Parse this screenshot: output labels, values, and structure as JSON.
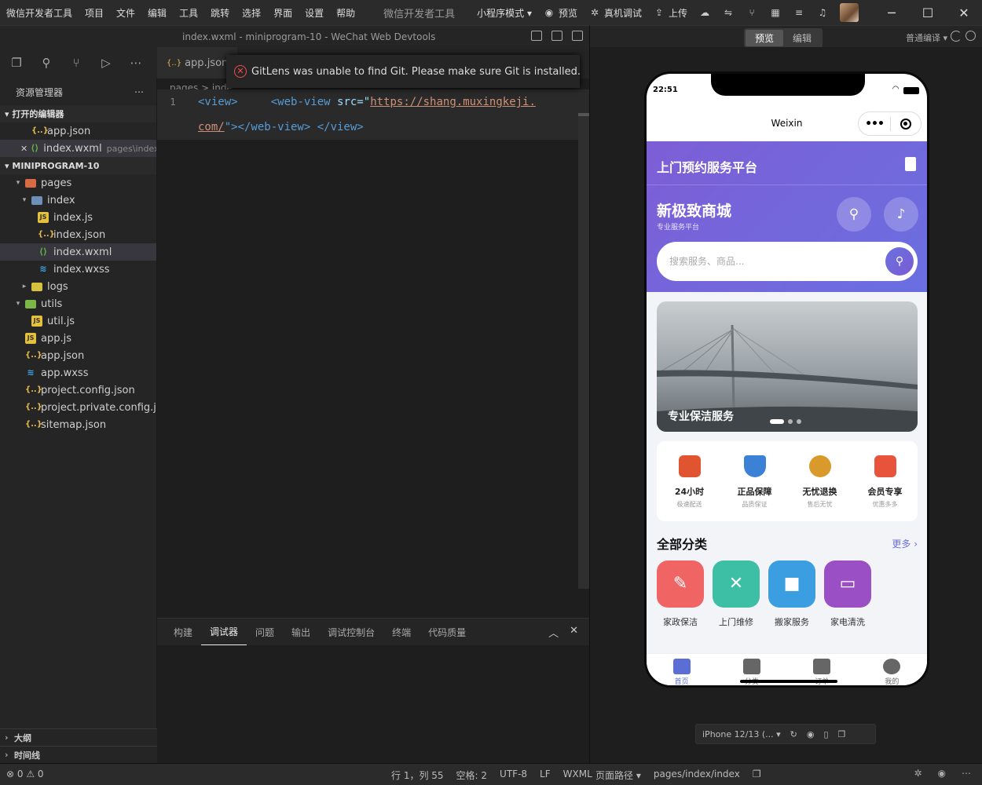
{
  "menubar": {
    "items": [
      "微信开发者工具",
      "项目",
      "文件",
      "编辑",
      "工具",
      "跳转",
      "选择",
      "界面",
      "设置",
      "帮助"
    ],
    "app_title": "微信开发者工具",
    "mode": "小程序模式 ▾",
    "preview": "预览",
    "device_debug": "真机调试",
    "upload": "上传"
  },
  "window": {
    "title": "index.wxml - miniprogram-10 - WeChat Web Devtools"
  },
  "simulator_bar": {
    "tabs": [
      "预览",
      "编辑"
    ],
    "compile": "普通编译 ▾"
  },
  "sidebar": {
    "header": "资源管理器",
    "open_editors_label": "打开的编辑器",
    "open_editors": [
      {
        "name": "app.json",
        "desc": ""
      },
      {
        "name": "index.wxml",
        "desc": "pages\\index"
      }
    ],
    "project_label": "MINIPROGRAM-10",
    "tree": [
      {
        "name": "pages",
        "depth": 1
      },
      {
        "name": "index",
        "depth": 2
      },
      {
        "name": "index.js",
        "depth": 3
      },
      {
        "name": "index.json",
        "depth": 3
      },
      {
        "name": "index.wxml",
        "depth": 3
      },
      {
        "name": "index.wxss",
        "depth": 3
      },
      {
        "name": "logs",
        "depth": 2
      },
      {
        "name": "utils",
        "depth": 1
      },
      {
        "name": "util.js",
        "depth": 2
      },
      {
        "name": "app.js",
        "depth": 1
      },
      {
        "name": "app.json",
        "depth": 1
      },
      {
        "name": "app.wxss",
        "depth": 1
      },
      {
        "name": "project.config.json",
        "depth": 1
      },
      {
        "name": "project.private.config.js...",
        "depth": 1
      },
      {
        "name": "sitemap.json",
        "depth": 1
      }
    ],
    "outline": "大纲",
    "timeline": "时间线"
  },
  "editor": {
    "tab": "app.json",
    "breadcrumb": "pages > inde",
    "line_number": "1",
    "code": {
      "open_view": "<view>",
      "webview_open": "<web-view",
      "src_attr": " src=",
      "quote": "\"",
      "url_part1": "https://shang.muxingkeji.",
      "url_part2": "com/",
      "close": "\"></web-view> </view>"
    }
  },
  "toast": {
    "message": "GitLens was unable to find Git. Please make sure Git is installed. Also e..."
  },
  "panel": {
    "tabs": [
      "构建",
      "调试器",
      "问题",
      "输出",
      "调试控制台",
      "终端",
      "代码质量"
    ],
    "active": "调试器"
  },
  "statusbar": {
    "problems": "⊗ 0  ⚠ 0",
    "position": "行 1，列 55",
    "spaces": "空格: 2",
    "encoding": "UTF-8",
    "eol": "LF",
    "language": "WXML",
    "page_path_label": "页面路径 ▾",
    "page_path": "pages/index/index"
  },
  "phone": {
    "time": "22:51",
    "nav_title": "Weixin",
    "app_name": "上门预约服务平台",
    "shop_name": "新极致商城",
    "shop_sub": "专业服务平台",
    "search_placeholder": "搜索服务、商品...",
    "banner_caption": "专业保洁服务",
    "features": [
      {
        "title": "24小时",
        "sub": "极速配送",
        "color": "#e0542f"
      },
      {
        "title": "正品保障",
        "sub": "品质保证",
        "color": "#3b82d6"
      },
      {
        "title": "无忧退换",
        "sub": "售后无忧",
        "color": "#d99a2b"
      },
      {
        "title": "会员专享",
        "sub": "优惠多多",
        "color": "#e7533b"
      }
    ],
    "categories_title": "全部分类",
    "more": "更多 ›",
    "categories": [
      {
        "label": "家政保洁",
        "color": "#f06464"
      },
      {
        "label": "上门维修",
        "color": "#3dbfa6"
      },
      {
        "label": "搬家服务",
        "color": "#3b9ee0"
      },
      {
        "label": "家电清洗",
        "color": "#9b4fc4"
      }
    ],
    "tabbar": [
      "首页",
      "分类",
      "订单",
      "我的"
    ]
  },
  "device_selector": "iPhone 12/13 (... ▾"
}
